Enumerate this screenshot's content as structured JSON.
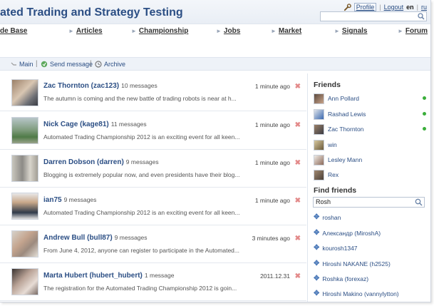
{
  "header": {
    "title": "ated Trading and Strategy Testing",
    "profile": "Profile",
    "logout": "Logout",
    "lang_en": "en",
    "lang_ru": "ru"
  },
  "nav": [
    "de Base",
    "Articles",
    "Championship",
    "Jobs",
    "Market",
    "Signals",
    "Forum"
  ],
  "submenu": {
    "main": "Main",
    "send": "Send message",
    "archive": "Archive",
    "sep": "|"
  },
  "messages": [
    {
      "name": "Zac Thornton (zac123)",
      "count": "10 messages",
      "preview": "The autumn is coming and the new battle of trading robots is near at h...",
      "time": "1 minute ago"
    },
    {
      "name": "Nick Cage (kage81)",
      "count": "11 messages",
      "preview": "Automated Trading Championship 2012 is an exciting event for all keen...",
      "time": "1 minute ago"
    },
    {
      "name": "Darren Dobson (darren)",
      "count": "9 messages",
      "preview": "Blogging is extremely popular now, and even presidents have their blog...",
      "time": "1 minute ago"
    },
    {
      "name": "ian75",
      "count": "9 messages",
      "preview": "Automated Trading Championship 2012 is an exciting event for all keen...",
      "time": "1 minute ago"
    },
    {
      "name": "Andrew Bull (bull87)",
      "count": "9 messages",
      "preview": "From June 4, 2012, anyone can register to participate in the Automated...",
      "time": "3 minutes ago"
    },
    {
      "name": "Marta Hubert (hubert_hubert)",
      "count": "1 message",
      "preview": "The registration for the Automated Trading Championship 2012 is goin...",
      "time": "2011.12.31"
    }
  ],
  "delete_glyph": "✖",
  "sidebar": {
    "friends_title": "Friends",
    "friends": [
      {
        "name": "Ann Pollard",
        "online": true
      },
      {
        "name": "Rashad Lewis",
        "online": true
      },
      {
        "name": "Zac Thornton",
        "online": true
      },
      {
        "name": "win",
        "online": false
      },
      {
        "name": "Lesley Mann",
        "online": false
      },
      {
        "name": "Rex",
        "online": false
      }
    ],
    "find_title": "Find friends",
    "find_value": "Rosh",
    "suggestions": [
      "roshan",
      "Александр (MiroshA)",
      "kourosh1347",
      "Hiroshi NAKANE (h2525)",
      "Roshka (forexaz)",
      "Hiroshi Makino (vannylytton)"
    ]
  },
  "colors": {
    "link": "#2b4e84",
    "online": "#3aae3a",
    "delete": "#e38a8a"
  }
}
